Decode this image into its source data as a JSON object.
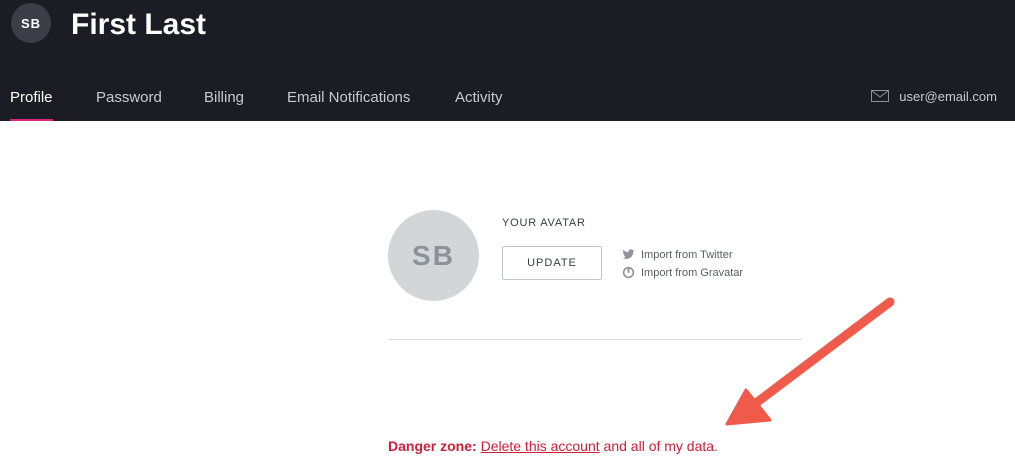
{
  "header": {
    "avatar_initials": "SB",
    "user_name": "First Last",
    "tabs": [
      {
        "label": "Profile",
        "active": true
      },
      {
        "label": "Password",
        "active": false
      },
      {
        "label": "Billing",
        "active": false
      },
      {
        "label": "Email Notifications",
        "active": false
      },
      {
        "label": "Activity",
        "active": false
      }
    ],
    "account_email": "user@email.com",
    "email_icon": "mail-icon"
  },
  "avatar_section": {
    "initials": "SB",
    "label": "YOUR AVATAR",
    "update_label": "UPDATE",
    "imports": [
      {
        "label": "Import from Twitter",
        "icon": "twitter-icon"
      },
      {
        "label": "Import from Gravatar",
        "icon": "gravatar-icon"
      }
    ]
  },
  "danger_zone": {
    "label": "Danger zone:",
    "link_text": "Delete this account",
    "suffix": "and all of my data."
  },
  "colors": {
    "header_bg": "#1b1c24",
    "tab_active_underline": "#e0267a",
    "danger": "#cc1f3a",
    "annotation_arrow": "#f05a4a"
  }
}
